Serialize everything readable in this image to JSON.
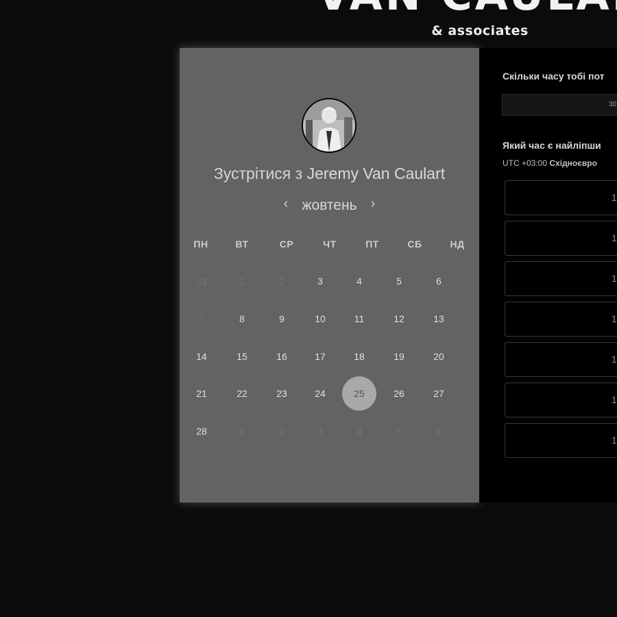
{
  "brand": {
    "title": "VAN CAULAR",
    "subtitle": "& associates"
  },
  "booking": {
    "title_prefix": "Зустрітися з",
    "host_name": "Jeremy Van Caulart",
    "month": "жовтень",
    "prev_arrow": "‹",
    "next_arrow": "›",
    "weekdays": [
      "ПН",
      "ВТ",
      "СР",
      "ЧТ",
      "ПТ",
      "СБ",
      "НД"
    ],
    "weeks": [
      [
        {
          "d": "31",
          "s": "dim"
        },
        {
          "d": "1",
          "s": "dim"
        },
        {
          "d": "2",
          "s": "dim"
        },
        {
          "d": "3",
          "s": "cur"
        },
        {
          "d": "4",
          "s": "cur"
        },
        {
          "d": "5",
          "s": "cur"
        },
        {
          "d": "6",
          "s": "cur"
        }
      ],
      [
        {
          "d": "7",
          "s": "dim"
        },
        {
          "d": "8",
          "s": "cur"
        },
        {
          "d": "9",
          "s": "cur"
        },
        {
          "d": "10",
          "s": "cur"
        },
        {
          "d": "11",
          "s": "cur"
        },
        {
          "d": "12",
          "s": "cur"
        },
        {
          "d": "13",
          "s": "cur"
        }
      ],
      [
        {
          "d": "14",
          "s": "cur"
        },
        {
          "d": "15",
          "s": "cur"
        },
        {
          "d": "16",
          "s": "cur"
        },
        {
          "d": "17",
          "s": "cur"
        },
        {
          "d": "18",
          "s": "cur"
        },
        {
          "d": "19",
          "s": "cur"
        },
        {
          "d": "20",
          "s": "cur"
        }
      ],
      [
        {
          "d": "21",
          "s": "cur"
        },
        {
          "d": "22",
          "s": "cur"
        },
        {
          "d": "23",
          "s": "cur"
        },
        {
          "d": "24",
          "s": "cur"
        },
        {
          "d": "25",
          "s": "sel"
        },
        {
          "d": "26",
          "s": "cur"
        },
        {
          "d": "27",
          "s": "cur"
        }
      ],
      [
        {
          "d": "28",
          "s": "cur"
        },
        {
          "d": "1",
          "s": "dim"
        },
        {
          "d": "2",
          "s": "dim"
        },
        {
          "d": "3",
          "s": "dim"
        },
        {
          "d": "4",
          "s": "dim"
        },
        {
          "d": "5",
          "s": "dim"
        },
        {
          "d": "6",
          "s": "dim"
        }
      ]
    ]
  },
  "form": {
    "duration_question": "Скільки часу тобі пот",
    "duration_value": "30",
    "time_question": "Який час є найліпши",
    "timezone_offset": "UTC +03:00",
    "timezone_name": "Східноєвро",
    "slots": [
      "1",
      "1",
      "1",
      "1",
      "1",
      "1",
      "1"
    ]
  },
  "colors": {
    "page_bg": "#0b0b0b",
    "calendar_bg": "#636363",
    "selected_day": "#a9a9a9",
    "right_panel_bg": "#000000"
  }
}
